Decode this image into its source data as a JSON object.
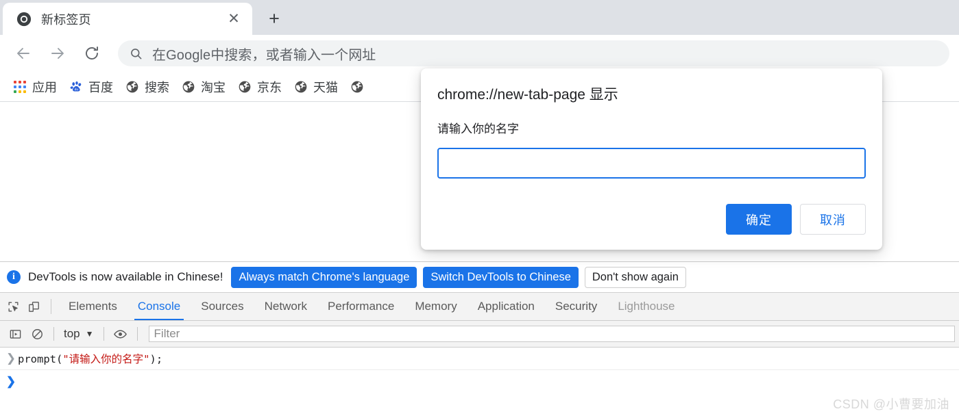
{
  "browser": {
    "tab": {
      "favicon": "chrome-logo-icon",
      "title": "新标签页",
      "close_label": "✕"
    },
    "new_tab_label": "+",
    "nav": {
      "back_label": "←",
      "forward_label": "→",
      "reload_label": "⟳"
    },
    "omnibox": {
      "icon": "search-icon",
      "placeholder": "在Google中搜索，或者输入一个网址"
    },
    "bookmarks": [
      {
        "label": "应用",
        "icon": "apps-grid-icon"
      },
      {
        "label": "百度",
        "icon": "baidu-paw-icon"
      },
      {
        "label": "搜索",
        "icon": "globe-icon"
      },
      {
        "label": "淘宝",
        "icon": "globe-icon"
      },
      {
        "label": "京东",
        "icon": "globe-icon"
      },
      {
        "label": "天猫",
        "icon": "globe-icon"
      },
      {
        "label": "",
        "icon": "globe-icon"
      }
    ]
  },
  "dialog": {
    "title": "chrome://new-tab-page 显示",
    "message": "请输入你的名字",
    "input_value": "",
    "input_placeholder": "",
    "confirm_label": "确定",
    "cancel_label": "取消",
    "accent_color": "#1a73e8"
  },
  "devtools": {
    "infobar": {
      "icon": "info-icon",
      "text": "DevTools is now available in Chinese!",
      "buttons": [
        {
          "label": "Always match Chrome's language",
          "style": "primary"
        },
        {
          "label": "Switch DevTools to Chinese",
          "style": "primary"
        },
        {
          "label": "Don't show again",
          "style": "ghost"
        }
      ]
    },
    "tool_icons": [
      {
        "name": "inspect-element-icon"
      },
      {
        "name": "device-toolbar-icon"
      }
    ],
    "tabs": [
      {
        "label": "Elements",
        "active": false,
        "dim": false
      },
      {
        "label": "Console",
        "active": true,
        "dim": false
      },
      {
        "label": "Sources",
        "active": false,
        "dim": false
      },
      {
        "label": "Network",
        "active": false,
        "dim": false
      },
      {
        "label": "Performance",
        "active": false,
        "dim": false
      },
      {
        "label": "Memory",
        "active": false,
        "dim": false
      },
      {
        "label": "Application",
        "active": false,
        "dim": false
      },
      {
        "label": "Security",
        "active": false,
        "dim": false
      },
      {
        "label": "Lighthouse",
        "active": false,
        "dim": true
      }
    ],
    "console_toolbar": {
      "sidebar_icon": "console-sidebar-icon",
      "clear_icon": "clear-console-icon",
      "context": "top",
      "context_caret": "▼",
      "eye_icon": "live-expression-eye-icon",
      "filter_placeholder": "Filter"
    },
    "console_rows": [
      {
        "arrow": "❯",
        "arrow_style": "gray",
        "code_before": "prompt(",
        "code_string": "\"请输入你的名字\"",
        "code_after": ");"
      },
      {
        "arrow": "❯",
        "arrow_style": "blue",
        "code_before": "",
        "code_string": "",
        "code_after": ""
      }
    ]
  },
  "watermark": "CSDN @小曹要加油"
}
